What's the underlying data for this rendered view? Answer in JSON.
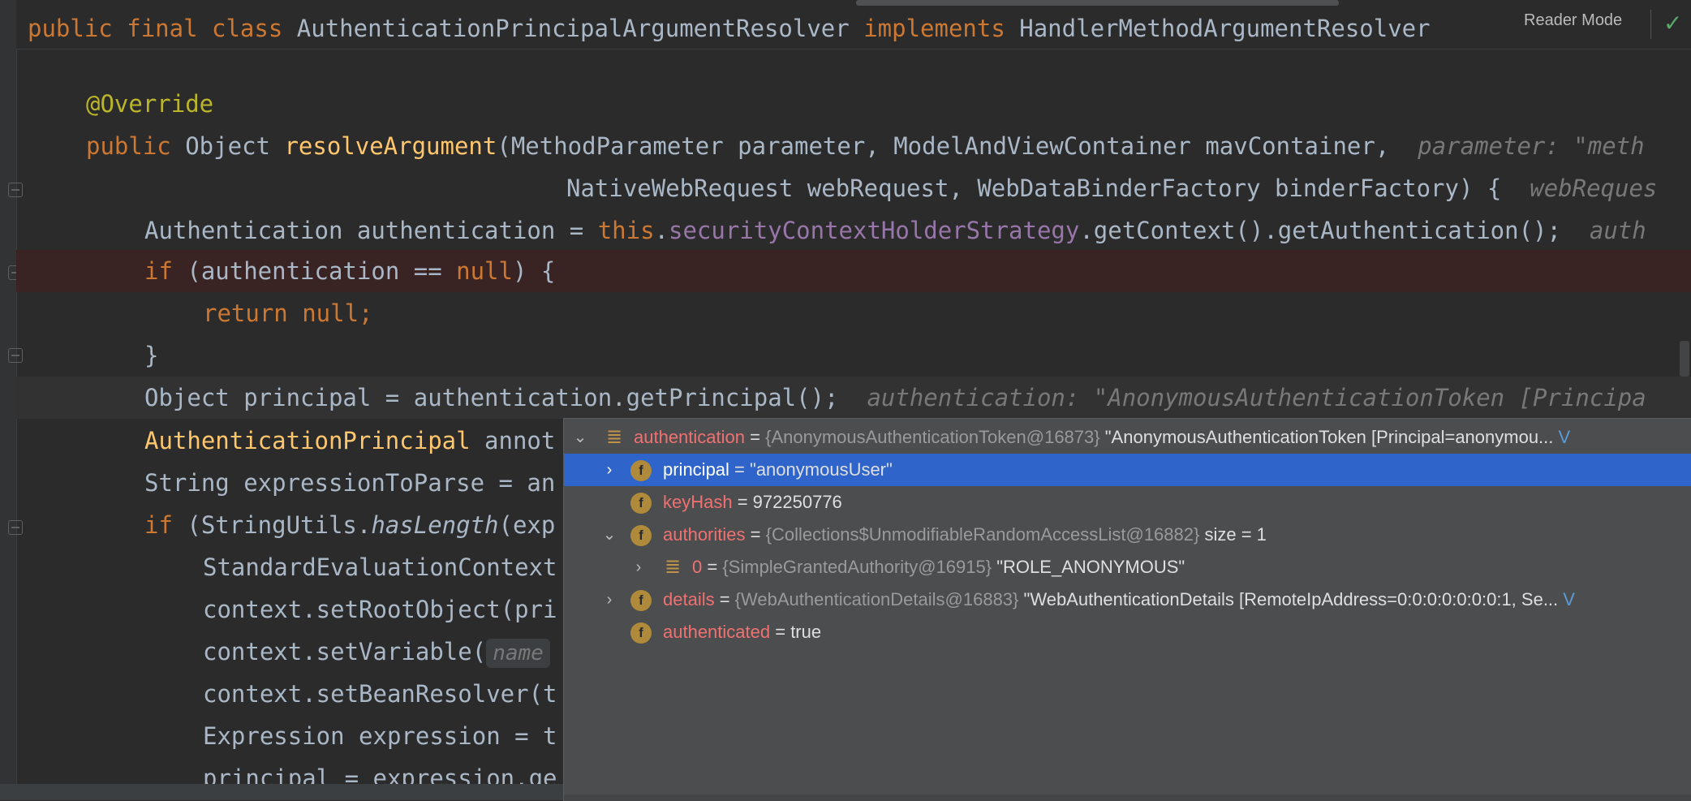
{
  "editor": {
    "class_decl": {
      "kw1": "public",
      "kw2": "final",
      "kw3": "class",
      "class_name": "AuthenticationPrincipalArgumentResolver",
      "kw4": "implements",
      "iface": "HandlerMethodArgumentResolver"
    },
    "reader_mode_label": "Reader Mode",
    "lines": {
      "l1": "@Override",
      "l2_kw": "public",
      "l2_type": " Object ",
      "l2_fn": "resolveArgument",
      "l2_rest": "(MethodParameter parameter, ModelAndViewContainer mavContainer,",
      "l2_hint": "parameter: \"meth",
      "l3": "NativeWebRequest webRequest, WebDataBinderFactory binderFactory) {",
      "l3_hint": "webReques",
      "l4_a": "Authentication authentication = ",
      "l4_this": "this",
      "l4_dot": ".",
      "l4_field": "securityContextHolderStrategy",
      "l4_rest": ".getContext().getAuthentication();",
      "l4_hint": "auth",
      "l5_kw": "if",
      "l5_a": " (authentication == ",
      "l5_null": "null",
      "l5_b": ") {",
      "l6_kw": "return null;",
      "l7": "}",
      "l8": "Object principal = authentication.getPrincipal();",
      "l8_hint": "authentication: \"AnonymousAuthenticationToken [Principa",
      "l9_type": "AuthenticationPrincipal",
      "l9_rest": " annot",
      "l10": "String expressionToParse = an",
      "l11_kw": "if",
      "l11_a": " (StringUtils.",
      "l11_it": "hasLength",
      "l11_b": "(exp",
      "l12": "StandardEvaluationContext",
      "l13": "context.setRootObject(pri",
      "l14_a": "context.setVariable(",
      "l14_chip": "name",
      "l15": "context.setBeanResolver(t",
      "l16": "Expression expression = t",
      "l17": "principal = expression.ge"
    }
  },
  "debug_popup": {
    "root": {
      "name": "authentication",
      "type": "{AnonymousAuthenticationToken@16873}",
      "value": "\"AnonymousAuthenticationToken [Principal=anonymou...",
      "link": "V"
    },
    "rows": [
      {
        "name": "principal",
        "eq": " = ",
        "value": "\"anonymousUser\""
      },
      {
        "name": "keyHash",
        "eq": " = ",
        "value": "972250776"
      },
      {
        "name": "authorities",
        "eq": " = ",
        "type": "{Collections$UnmodifiableRandomAccessList@16882}",
        "value": "size = 1"
      },
      {
        "name": "0",
        "eq": " = ",
        "type": "{SimpleGrantedAuthority@16915}",
        "value": "\"ROLE_ANONYMOUS\""
      },
      {
        "name": "details",
        "eq": " = ",
        "type": "{WebAuthenticationDetails@16883}",
        "value": "\"WebAuthenticationDetails [RemoteIpAddress=0:0:0:0:0:0:0:1, Se...",
        "link": "V"
      },
      {
        "name": "authenticated",
        "eq": " = ",
        "value": "true"
      }
    ]
  },
  "colors": {
    "background": "#2b2b2b",
    "keyword": "#cc7832",
    "annotation": "#bbb529",
    "method": "#ffc66d",
    "field": "#9876aa",
    "selection": "#2f65ca"
  }
}
